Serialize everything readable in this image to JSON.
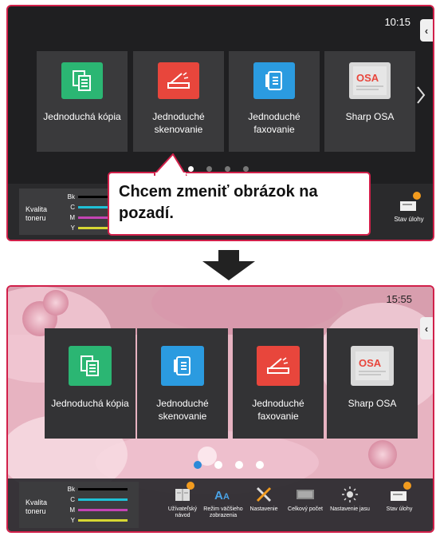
{
  "top_screen": {
    "clock": "10:15",
    "tiles": [
      {
        "label": "Jednoduchá kópia",
        "icon": "copy-icon",
        "color": "#2bb673"
      },
      {
        "label": "Jednoduché skenovanie",
        "icon": "scan-icon",
        "color": "#e8463c"
      },
      {
        "label": "Jednoduché faxovanie",
        "icon": "fax-icon",
        "color": "#2b9be0"
      },
      {
        "label": "Sharp OSA",
        "icon": "sharp-osa-icon",
        "color": "#d9d9d9"
      }
    ],
    "page_dots": 4,
    "active_dot": 0,
    "toner": {
      "title": "Kvalita toneru",
      "rows": [
        {
          "label": "Bk",
          "color": "#000000"
        },
        {
          "label": "C",
          "color": "#1fc0d6"
        },
        {
          "label": "M",
          "color": "#c444b4"
        },
        {
          "label": "Y",
          "color": "#d6d633"
        }
      ]
    },
    "job_status_label": "Stav úlohy"
  },
  "callout": {
    "line1": "Chcem zmeniť obrázok na",
    "line2": "pozadí."
  },
  "bottom_screen": {
    "clock": "15:55",
    "tiles": [
      {
        "label": "Jednoduchá kópia",
        "icon": "copy-icon",
        "color": "#2bb673"
      },
      {
        "label": "Jednoduché skenovanie",
        "icon": "fax-icon",
        "color": "#2b9be0"
      },
      {
        "label": "Jednoduché faxovanie",
        "icon": "scan-icon",
        "color": "#e8463c"
      },
      {
        "label": "Sharp OSA",
        "icon": "sharp-osa-icon",
        "color": "#d9d9d9"
      }
    ],
    "page_dots": 4,
    "active_dot": 0,
    "toner": {
      "title": "Kvalita toneru",
      "rows": [
        {
          "label": "Bk",
          "color": "#000000"
        },
        {
          "label": "C",
          "color": "#1fc0d6"
        },
        {
          "label": "M",
          "color": "#c444b4"
        },
        {
          "label": "Y",
          "color": "#d6d633"
        }
      ]
    },
    "bar_items": [
      {
        "label": "Užívateľský návod",
        "icon": "manual-icon"
      },
      {
        "label": "Režim väčšieho zobrazenia",
        "icon": "large-text-icon"
      },
      {
        "label": "Nastavenie",
        "icon": "settings-tools-icon"
      },
      {
        "label": "Celkový počet",
        "icon": "counter-icon"
      },
      {
        "label": "Nastavenie jasu",
        "icon": "brightness-icon"
      },
      {
        "label": "Stav úlohy",
        "icon": "job-status-icon"
      }
    ]
  }
}
